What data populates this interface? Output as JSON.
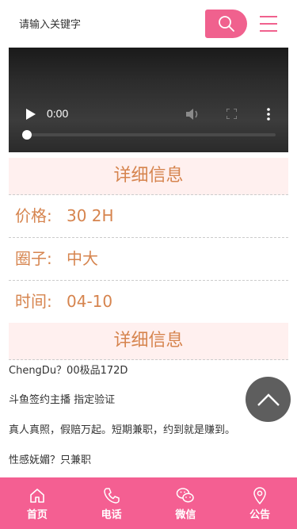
{
  "search": {
    "placeholder": "请输入关键字"
  },
  "video": {
    "time": "0:00",
    "progress": 0
  },
  "sections": {
    "header1": "详细信息",
    "header2": "详细信息"
  },
  "info": [
    {
      "label": "价格:",
      "value": "30 2H"
    },
    {
      "label": "圈子:",
      "value": "中大"
    },
    {
      "label": "时间:",
      "value": "04-10"
    }
  ],
  "details": [
    "ChengDu？00极品172D",
    "斗鱼签约主播 指定验证",
    "真人真照，假赔万起。短期兼职，约到就是赚到。",
    "性感妩媚？只兼职"
  ],
  "nav": [
    {
      "label": "首页",
      "icon": "home-icon"
    },
    {
      "label": "电话",
      "icon": "phone-icon"
    },
    {
      "label": "微信",
      "icon": "wechat-icon"
    },
    {
      "label": "公告",
      "icon": "location-pin-icon"
    }
  ],
  "colors": {
    "accent": "#f0618e",
    "nav_bg": "#f45f92",
    "text_orange": "#d6844e",
    "header_bg": "#fff0ef"
  }
}
